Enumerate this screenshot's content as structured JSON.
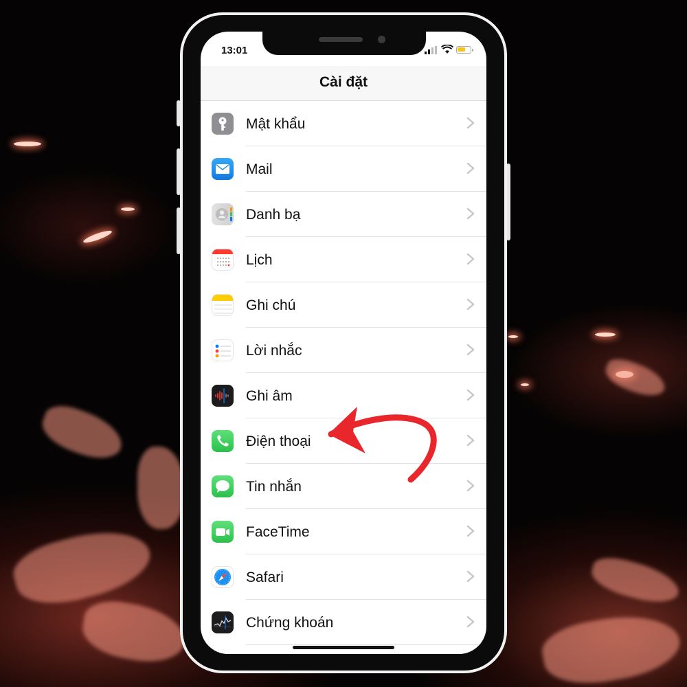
{
  "status_bar": {
    "time": "13:01"
  },
  "nav": {
    "title": "Cài đặt"
  },
  "rows": [
    {
      "label": "Mật khẩu",
      "icon": "key-icon",
      "color": "#8e8e93"
    },
    {
      "label": "Mail",
      "icon": "mail-icon",
      "color": "#1e88e5"
    },
    {
      "label": "Danh bạ",
      "icon": "contacts-icon",
      "color": "#d8d8d8"
    },
    {
      "label": "Lịch",
      "icon": "calendar-icon",
      "color": "#ffffff"
    },
    {
      "label": "Ghi chú",
      "icon": "notes-icon",
      "color": "#ffffff"
    },
    {
      "label": "Lời nhắc",
      "icon": "reminders-icon",
      "color": "#ffffff"
    },
    {
      "label": "Ghi âm",
      "icon": "voice-memos-icon",
      "color": "#1c1c1e"
    },
    {
      "label": "Điện thoại",
      "icon": "phone-icon",
      "color": "#34c759"
    },
    {
      "label": "Tin nhắn",
      "icon": "messages-icon",
      "color": "#34c759"
    },
    {
      "label": "FaceTime",
      "icon": "facetime-icon",
      "color": "#34c759"
    },
    {
      "label": "Safari",
      "icon": "safari-icon",
      "color": "#1e88e5"
    },
    {
      "label": "Chứng khoán",
      "icon": "stocks-icon",
      "color": "#1c1c1e"
    }
  ],
  "colors": {
    "annotation_arrow": "#e8262b"
  }
}
